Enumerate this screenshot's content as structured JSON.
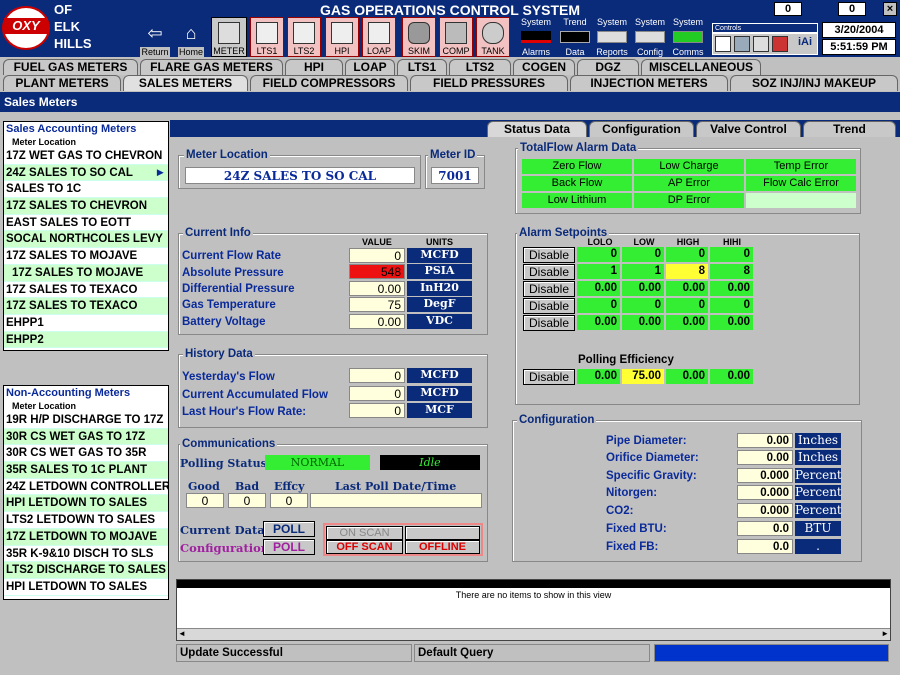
{
  "app": {
    "title": "GAS OPERATIONS CONTROL SYSTEM",
    "logo_oxy": "OXY",
    "logo_lines": [
      "OF",
      "ELK",
      "HILLS"
    ],
    "counter_left": "0",
    "counter_right": "0",
    "date": "3/20/2004",
    "time": "5:51:59 PM",
    "controls_label": "Controls",
    "iai": "iAi"
  },
  "toolbar": {
    "return": "Return",
    "home": "Home",
    "meter": "METER",
    "lts1": "LTS1",
    "lts2": "LTS2",
    "hpi": "HPI",
    "loap": "LOAP",
    "skim": "SKIM",
    "comp": "COMP",
    "tank": "TANK",
    "sys_alarms_top": "System",
    "sys_alarms": "Alarms",
    "trend_top": "Trend",
    "trend_data": "Data",
    "sys_reports_top": "System",
    "sys_reports": "Reports",
    "sys_config_top": "System",
    "sys_config": "Config",
    "sys_comms_top": "System",
    "sys_comms": "Comms"
  },
  "tabs_row1": [
    "FUEL GAS METERS",
    "FLARE GAS METERS",
    "HPI",
    "LOAP",
    "LTS1",
    "LTS2",
    "COGEN",
    "DGZ",
    "MISCELLANEOUS"
  ],
  "tabs_row2": [
    "PLANT METERS",
    "SALES METERS",
    "FIELD COMPRESSORS",
    "FIELD PRESSURES",
    "INJECTION METERS",
    "SOZ INJ/INJ MAKEUP"
  ],
  "section_title": "Sales Meters",
  "sales_accounting": {
    "title": "Sales Accounting Meters",
    "subtitle": "Meter Location",
    "items": [
      "17Z WET GAS TO CHEVRON",
      "24Z SALES TO SO CAL",
      "SALES TO 1C",
      "17Z SALES TO CHEVRON",
      "EAST SALES TO EOTT",
      "SOCAL NORTHCOLES LEVY",
      "17Z SALES TO MOJAVE",
      "17Z SALES TO MOJAVE",
      "17Z SALES TO TEXACO",
      "17Z SALES TO TEXACO",
      "EHPP1",
      "EHPP2"
    ]
  },
  "non_accounting": {
    "title": "Non-Accounting Meters",
    "subtitle": "Meter Location",
    "items": [
      "19R H/P DISCHARGE TO 17Z",
      "30R CS WET GAS TO 17Z",
      "30R CS WET GAS TO 35R",
      "35R SALES TO 1C PLANT",
      "24Z LETDOWN CONTROLLER",
      "HPI LETDOWN TO SALES",
      "LTS2 LETDOWN TO SALES",
      "17Z LETDOWN TO MOJAVE",
      "35R K-9&10 DISCH TO SLS",
      "LTS2 DISCHARGE TO SALES",
      "HPI LETDOWN TO SALES"
    ]
  },
  "detail_tabs": [
    "Status Data",
    "Configuration",
    "Valve Control",
    "Trend"
  ],
  "meter": {
    "location_label": "Meter Location",
    "location": "24Z SALES TO SO CAL",
    "id_label": "Meter ID",
    "id": "7001"
  },
  "current_info": {
    "title": "Current Info",
    "value_hdr": "VALUE",
    "units_hdr": "UNITS",
    "rows": [
      {
        "label": "Current Flow Rate",
        "value": "0",
        "unit": "MCFD"
      },
      {
        "label": "Absolute Pressure",
        "value": "548",
        "unit": "PSIA"
      },
      {
        "label": "Differential Pressure",
        "value": "0.00",
        "unit": "InH20"
      },
      {
        "label": "Gas Temperature",
        "value": "75",
        "unit": "DegF"
      },
      {
        "label": "Battery Voltage",
        "value": "0.00",
        "unit": "VDC"
      }
    ]
  },
  "history": {
    "title": "History Data",
    "rows": [
      {
        "label": "Yesterday's Flow",
        "value": "0",
        "unit": "MCFD"
      },
      {
        "label": "Current Accumulated Flow",
        "value": "0",
        "unit": "MCFD"
      },
      {
        "label": "Last Hour's Flow Rate:",
        "value": "0",
        "unit": "MCF"
      }
    ]
  },
  "comms": {
    "title": "Communications",
    "polling_label": "Polling Status:",
    "polling_status": "NORMAL",
    "idle": "Idle",
    "good_label": "Good",
    "bad_label": "Bad",
    "effcy_label": "Effcy",
    "lastpoll_label": "Last Poll Date/Time",
    "good": "0",
    "bad": "0",
    "effcy": "0",
    "current_data_label": "Current Data",
    "configuration_label": "Configuration",
    "poll": "POLL",
    "on_scan": "ON SCAN",
    "off_scan": "OFF SCAN",
    "offline": "OFFLINE"
  },
  "totalflow": {
    "title": "TotalFlow Alarm Data",
    "alarms": [
      "Zero Flow",
      "Low Charge",
      "Temp Error",
      "Back Flow",
      "AP Error",
      "Flow Calc Error",
      "Low Lithium",
      "DP Error"
    ]
  },
  "setpoints": {
    "title": "Alarm Setpoints",
    "headers": [
      "LOLO",
      "LOW",
      "HIGH",
      "HIHI"
    ],
    "disable": "Disable",
    "rows": [
      [
        "0",
        "0",
        "0",
        "0"
      ],
      [
        "1",
        "1",
        "8",
        "8"
      ],
      [
        "0.00",
        "0.00",
        "0.00",
        "0.00"
      ],
      [
        "0",
        "0",
        "0",
        "0"
      ],
      [
        "0.00",
        "0.00",
        "0.00",
        "0.00"
      ]
    ]
  },
  "polling_eff": {
    "title": "Polling Efficiency",
    "values": [
      "0.00",
      "75.00",
      "0.00",
      "0.00"
    ]
  },
  "configuration": {
    "title": "Configuration",
    "rows": [
      {
        "label": "Pipe Diameter:",
        "value": "0.00",
        "unit": "Inches"
      },
      {
        "label": "Orifice Diameter:",
        "value": "0.00",
        "unit": "Inches"
      },
      {
        "label": "Specific Gravity:",
        "value": "0.000",
        "unit": "Percent"
      },
      {
        "label": "Nitorgen:",
        "value": "0.000",
        "unit": "Percent"
      },
      {
        "label": "CO2:",
        "value": "0.000",
        "unit": "Percent"
      },
      {
        "label": "Fixed BTU:",
        "value": "0.0",
        "unit": "BTU"
      },
      {
        "label": "Fixed FB:",
        "value": "0.0",
        "unit": "."
      }
    ]
  },
  "listview": {
    "empty_text": "There are no items to show in this view"
  },
  "status": {
    "left": "Update Successful",
    "middle": "Default Query"
  },
  "colors": {
    "navy": "#0a2a7a",
    "green": "#33ee33",
    "red_value": "#ee1111",
    "yellow": "#ffff33"
  }
}
